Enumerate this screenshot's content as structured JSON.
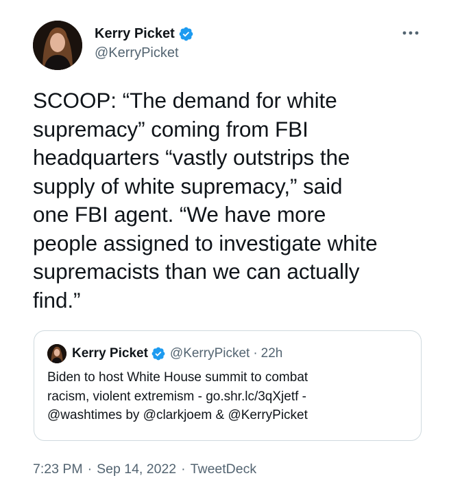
{
  "author": {
    "display_name": "Kerry Picket",
    "handle": "@KerryPicket",
    "verified_icon": "verified-badge-icon"
  },
  "more_icon": "more-horizontal-icon",
  "tweet": {
    "text": "SCOOP: “The demand for white\nsupremacy” coming from FBI\nheadquarters “vastly outstrips the\nsupply of white supremacy,” said\none FBI agent. “We have more\npeople assigned to investigate white\nsupremacists than we can actually\nfind.”"
  },
  "quote": {
    "display_name": "Kerry Picket",
    "handle": "@KerryPicket",
    "separator": "·",
    "time": "22h",
    "text": "Biden to host White House summit to combat\nracism, violent extremism - go.shr.lc/3qXjetf -\n@washtimes  by @clarkjoem & @KerryPicket"
  },
  "meta": {
    "time": "7:23 PM",
    "separator1": "·",
    "date": "Sep 14, 2022",
    "separator2": "·",
    "source": "TweetDeck"
  },
  "colors": {
    "text": "#0f1419",
    "secondary": "#536471",
    "verified": "#1d9bf0",
    "border": "#cfd9de"
  }
}
